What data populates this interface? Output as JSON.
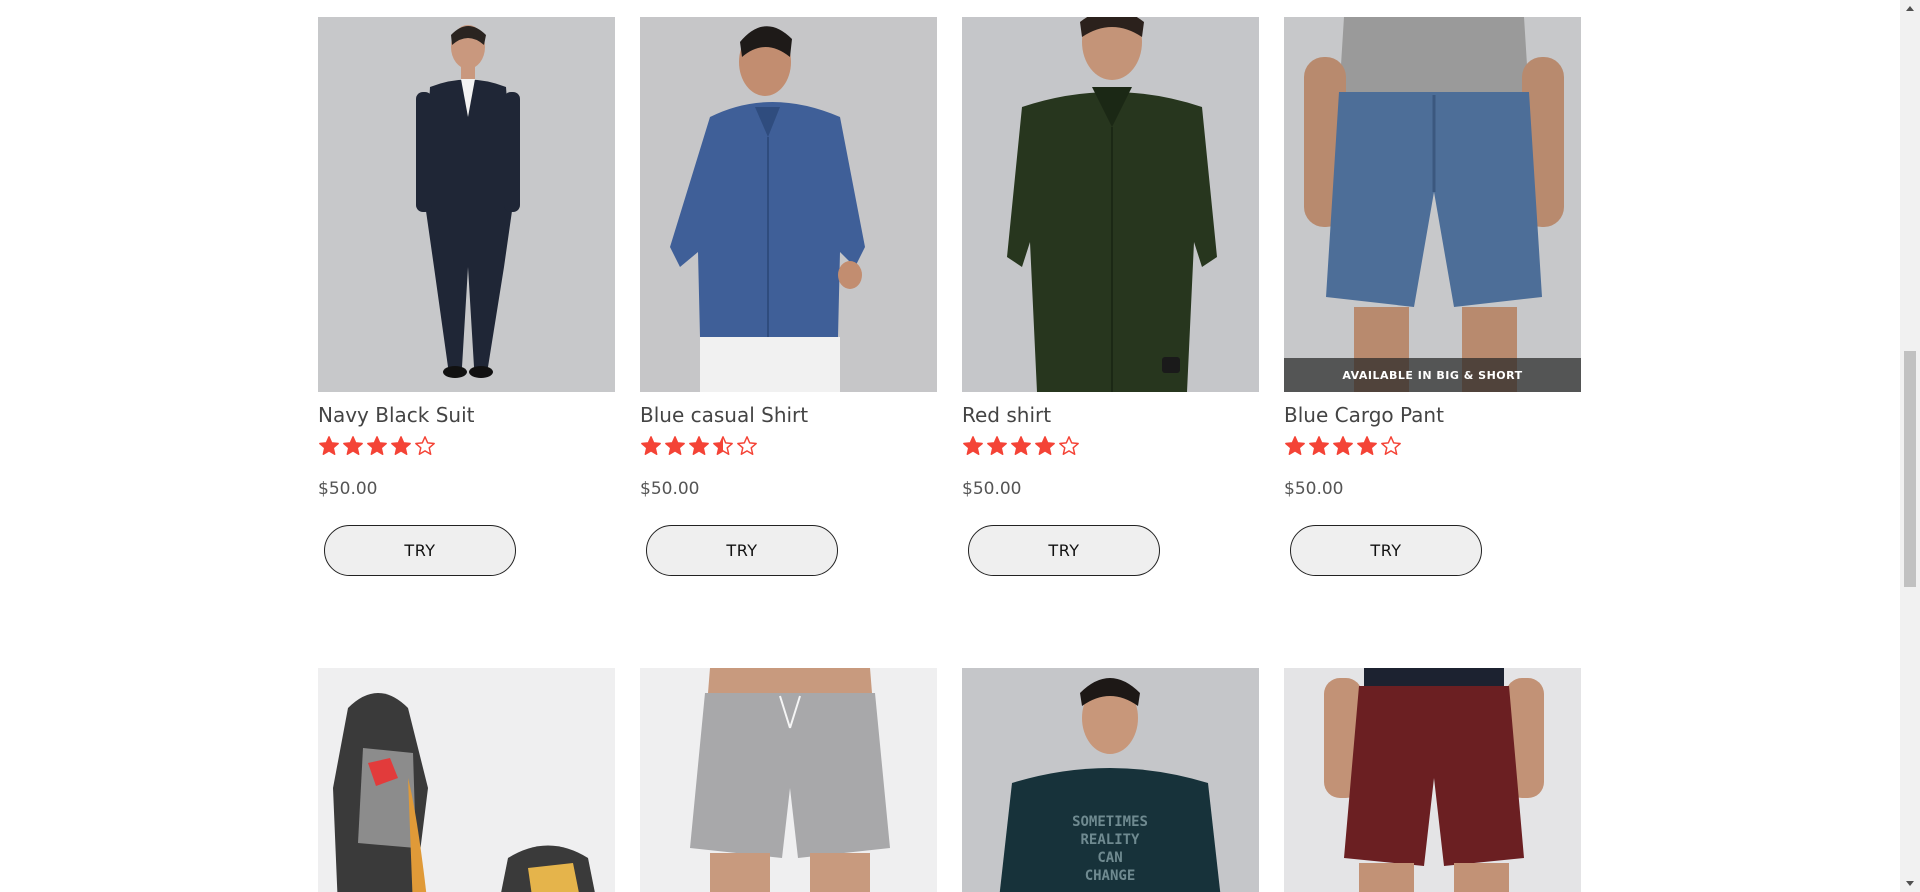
{
  "products_row1": [
    {
      "name": "Navy Black Suit",
      "rating": 4,
      "price": "$50.00",
      "button": "TRY",
      "image": "suit-photo"
    },
    {
      "name": "Blue casual Shirt",
      "rating": 3.5,
      "price": "$50.00",
      "button": "TRY",
      "image": "blue-shirt-photo"
    },
    {
      "name": "Red shirt",
      "rating": 4,
      "price": "$50.00",
      "button": "TRY",
      "image": "green-shirt-photo"
    },
    {
      "name": "Blue Cargo Pant",
      "rating": 4,
      "price": "$50.00",
      "button": "TRY",
      "image": "denim-shorts-photo",
      "badge": "AVAILABLE IN BIG & SHORT"
    }
  ],
  "products_row2": [
    {
      "image": "sneakers-photo"
    },
    {
      "image": "grey-shorts-photo"
    },
    {
      "image": "tshirt-photo",
      "print": "SOMETIMES REALITY CAN CHANGE"
    },
    {
      "image": "maroon-shorts-photo"
    }
  ],
  "colors": {
    "star": "#f44336",
    "button_bg": "#efefef",
    "text": "#444444"
  },
  "icons": {
    "star_full": "star-icon",
    "star_half": "star-half-icon",
    "star_empty": "star-outline-icon"
  }
}
